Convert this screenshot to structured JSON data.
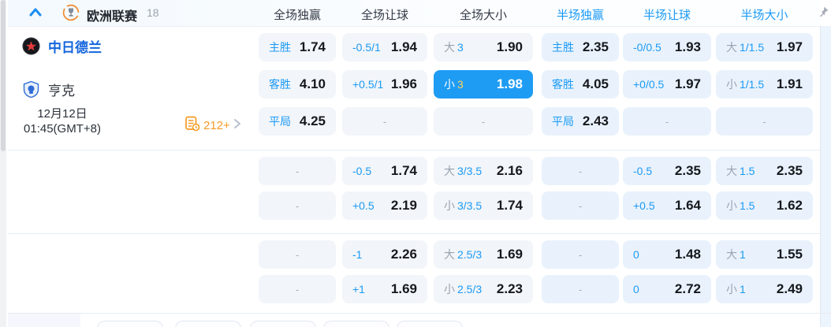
{
  "league_header": {
    "title": "欧洲联赛",
    "match_count": "18",
    "collapse_icon": "chevron-up-icon",
    "trophy_icon": "europa-league-trophy-icon",
    "pin_icon": "pin-icon"
  },
  "columns": [
    {
      "key": "ft-1x2",
      "label": "全场独赢",
      "scope": "full"
    },
    {
      "key": "ft-handicap",
      "label": "全场让球",
      "scope": "full"
    },
    {
      "key": "ft-ou",
      "label": "全场大小",
      "scope": "full"
    },
    {
      "key": "ht-1x2",
      "label": "半场独赢",
      "scope": "half"
    },
    {
      "key": "ht-handicap",
      "label": "半场让球",
      "scope": "half"
    },
    {
      "key": "ht-ou",
      "label": "半场大小",
      "scope": "half"
    }
  ],
  "match": {
    "home_team": "中日德兰",
    "away_team": "亨克",
    "date": "12月12日",
    "time": "01:45(GMT+8)",
    "more_markets_label": "212+"
  },
  "empty_placeholder": "-",
  "odds_blocks": [
    {
      "rows": [
        {
          "cells": [
            {
              "line": "主胜",
              "value": "1.74"
            },
            {
              "line": "-0.5/1",
              "value": "1.94"
            },
            {
              "prefix": "大",
              "line": "3",
              "value": "1.90"
            },
            {
              "line": "主胜",
              "value": "2.35"
            },
            {
              "line": "-0/0.5",
              "value": "1.93"
            },
            {
              "prefix": "大",
              "line": "1/1.5",
              "value": "1.97"
            }
          ]
        },
        {
          "cells": [
            {
              "line": "客胜",
              "value": "4.10"
            },
            {
              "line": "+0.5/1",
              "value": "1.96"
            },
            {
              "prefix": "小",
              "line": "3",
              "value": "1.98",
              "selected": true
            },
            {
              "line": "客胜",
              "value": "4.05"
            },
            {
              "line": "+0/0.5",
              "value": "1.97"
            },
            {
              "prefix": "小",
              "line": "1/1.5",
              "value": "1.91"
            }
          ]
        },
        {
          "cells": [
            {
              "line": "平局",
              "value": "4.25"
            },
            {
              "empty": true
            },
            {
              "empty": true
            },
            {
              "line": "平局",
              "value": "2.43"
            },
            {
              "empty": true
            },
            {
              "empty": true
            }
          ]
        }
      ]
    },
    {
      "rows": [
        {
          "cells": [
            {
              "empty": true
            },
            {
              "line": "-0.5",
              "value": "1.74"
            },
            {
              "prefix": "大",
              "line": "3/3.5",
              "value": "2.16"
            },
            {
              "empty": true
            },
            {
              "line": "-0.5",
              "value": "2.35"
            },
            {
              "prefix": "大",
              "line": "1.5",
              "value": "2.35"
            }
          ]
        },
        {
          "cells": [
            {
              "empty": true
            },
            {
              "line": "+0.5",
              "value": "2.19"
            },
            {
              "prefix": "小",
              "line": "3/3.5",
              "value": "1.74"
            },
            {
              "empty": true
            },
            {
              "line": "+0.5",
              "value": "1.64"
            },
            {
              "prefix": "小",
              "line": "1.5",
              "value": "1.62"
            }
          ]
        }
      ]
    },
    {
      "rows": [
        {
          "cells": [
            {
              "empty": true
            },
            {
              "line": "-1",
              "value": "2.26"
            },
            {
              "prefix": "大",
              "line": "2.5/3",
              "value": "1.69"
            },
            {
              "empty": true
            },
            {
              "line": "0",
              "value": "1.48"
            },
            {
              "prefix": "大",
              "line": "1",
              "value": "1.55"
            }
          ]
        },
        {
          "cells": [
            {
              "empty": true
            },
            {
              "line": "+1",
              "value": "1.69"
            },
            {
              "prefix": "小",
              "line": "2.5/3",
              "value": "2.23"
            },
            {
              "empty": true
            },
            {
              "line": "0",
              "value": "2.72"
            },
            {
              "prefix": "小",
              "line": "1",
              "value": "2.49"
            }
          ]
        }
      ]
    }
  ],
  "bottom": {
    "partial_chip_count": 5
  },
  "colors": {
    "accent_blue": "#1b9af5",
    "selected_cell_bg": "#1e9cf4",
    "selected_line_gold": "#ffd257",
    "odds_text": "#15181d",
    "full_cell_bg": "#f2f5f9",
    "half_cell_bg": "#e9f2fc",
    "orange": "#f59b25",
    "home_team_blue": "#1566dd"
  }
}
